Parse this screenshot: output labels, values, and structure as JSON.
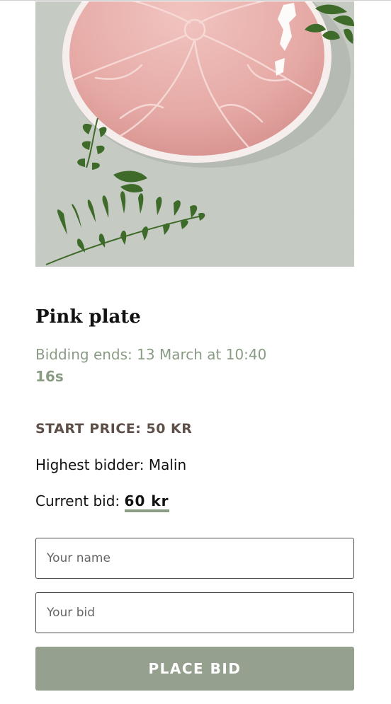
{
  "product": {
    "title": "Pink plate",
    "bidding_ends": "Bidding ends: 13 March at 10:40",
    "countdown": "16s",
    "start_price": "START PRICE: 50 KR",
    "highest_bidder_label": "Highest bidder: ",
    "highest_bidder_name": "Malin",
    "current_bid_label": "Current bid: ",
    "current_bid_value": "60 kr"
  },
  "form": {
    "name_placeholder": "Your name",
    "bid_placeholder": "Your bid",
    "submit_label": "PLACE BID"
  },
  "colors": {
    "accent": "#8a9c84",
    "button": "#95a08f",
    "start_price": "#5e5049",
    "plate_pink": "#e8b2ae"
  }
}
